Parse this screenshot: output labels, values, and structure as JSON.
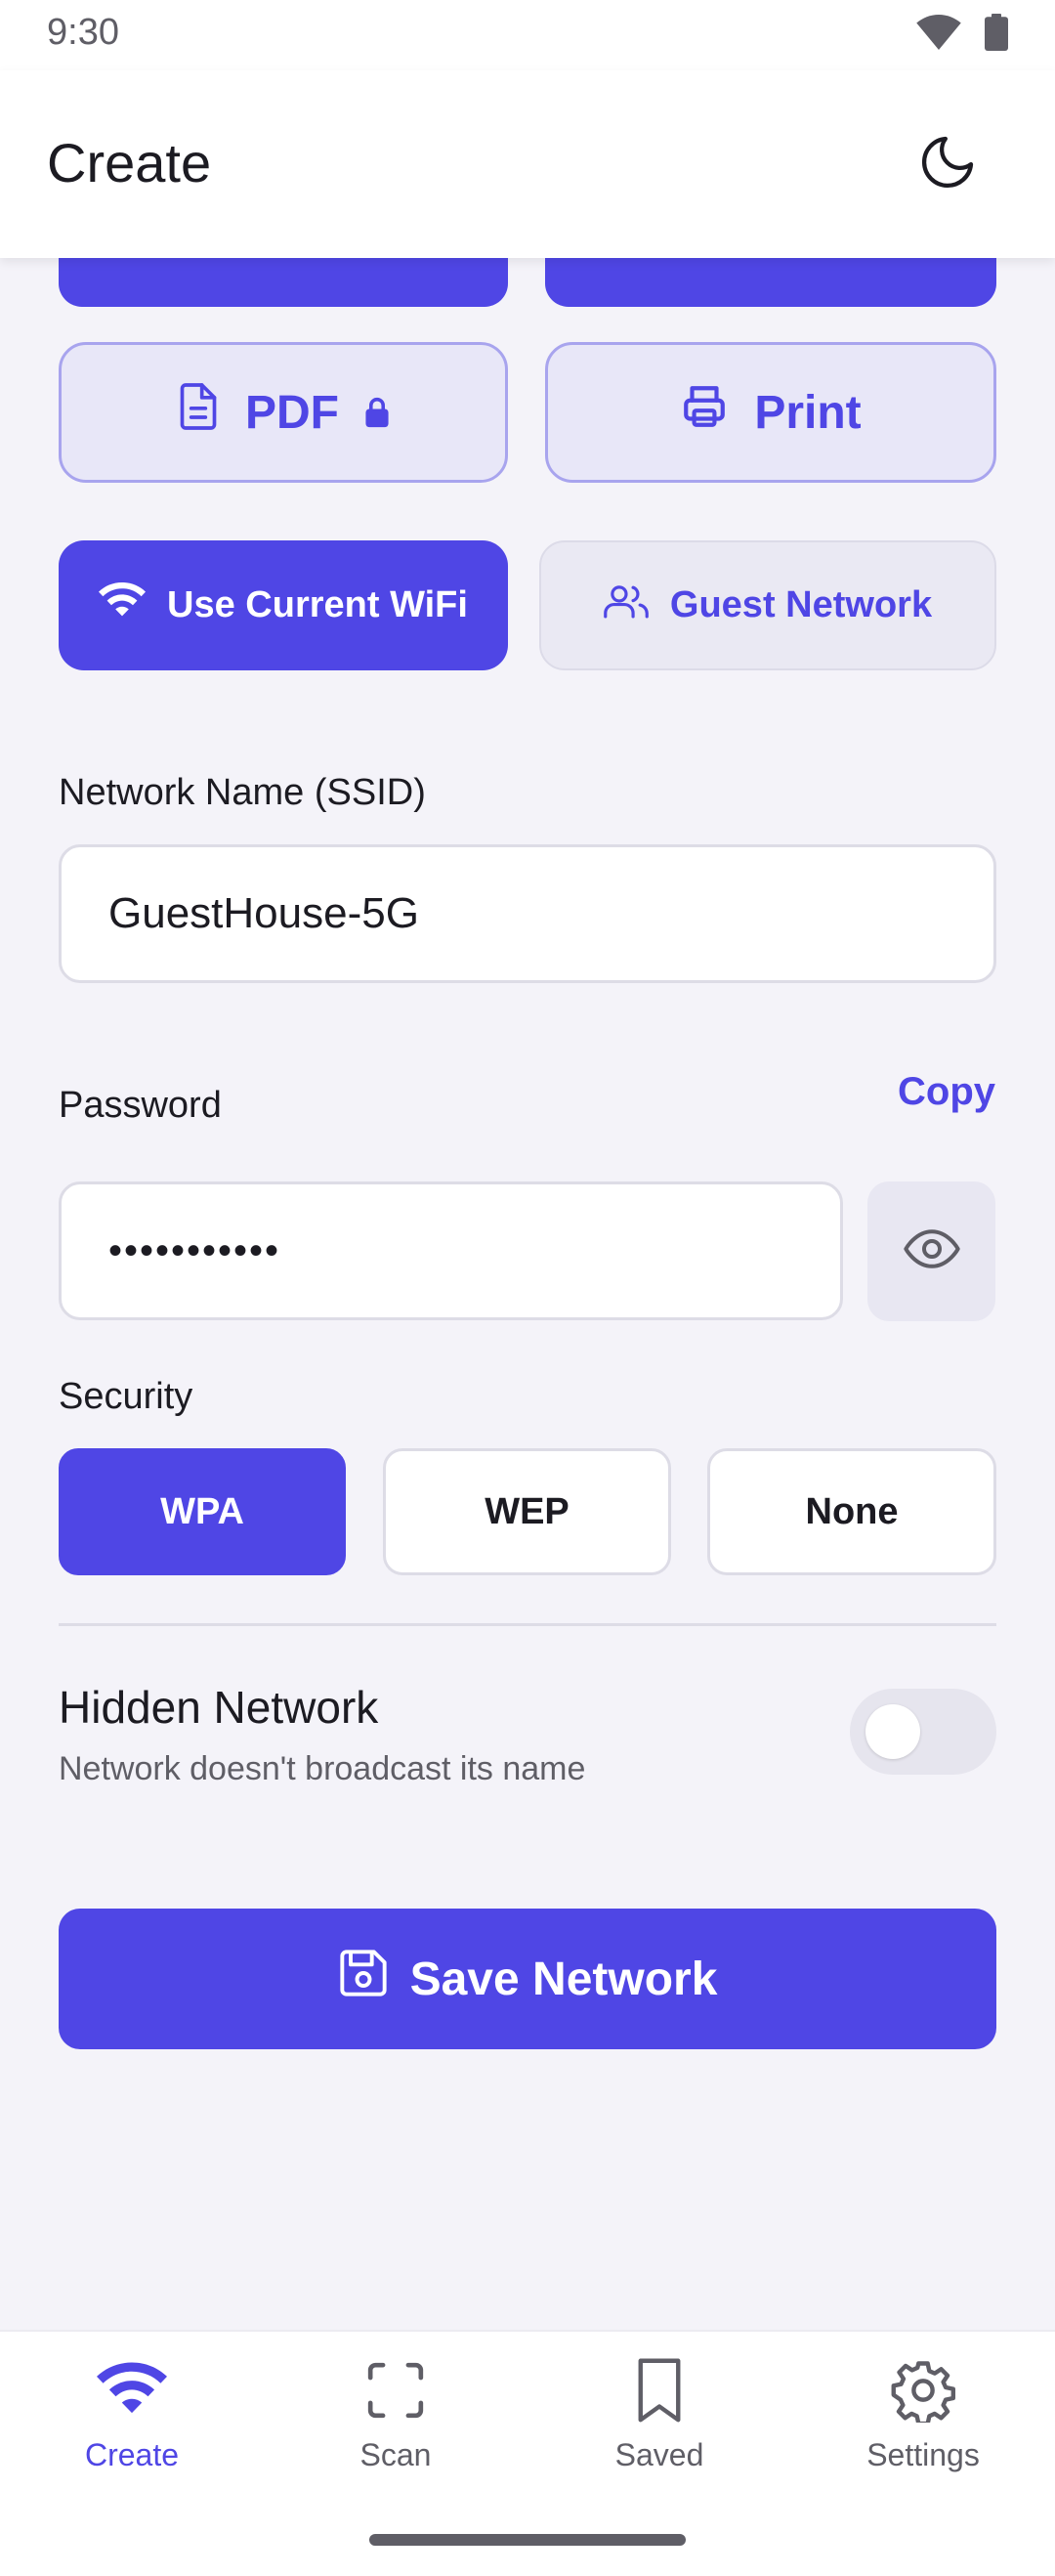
{
  "status_bar": {
    "time": "9:30"
  },
  "app_bar": {
    "title": "Create"
  },
  "export": {
    "pdf_label": "PDF",
    "print_label": "Print"
  },
  "presets": {
    "current_wifi_label": "Use Current WiFi",
    "guest_network_label": "Guest Network"
  },
  "ssid": {
    "label": "Network Name (SSID)",
    "value": "GuestHouse-5G"
  },
  "password": {
    "label": "Password",
    "copy_label": "Copy",
    "masked_value": "•••••••••••"
  },
  "security": {
    "label": "Security",
    "options": [
      "WPA",
      "WEP",
      "None"
    ],
    "selected": "WPA"
  },
  "hidden_network": {
    "title": "Hidden Network",
    "subtitle": "Network doesn't broadcast its name",
    "enabled": false
  },
  "save": {
    "label": "Save Network"
  },
  "bottom_nav": {
    "items": [
      {
        "label": "Create",
        "icon": "wifi-icon",
        "active": true
      },
      {
        "label": "Scan",
        "icon": "scan-icon",
        "active": false
      },
      {
        "label": "Saved",
        "icon": "bookmark-icon",
        "active": false
      },
      {
        "label": "Settings",
        "icon": "gear-icon",
        "active": false
      }
    ]
  },
  "colors": {
    "accent": "#4f46e5",
    "background": "#f4f3f9"
  }
}
